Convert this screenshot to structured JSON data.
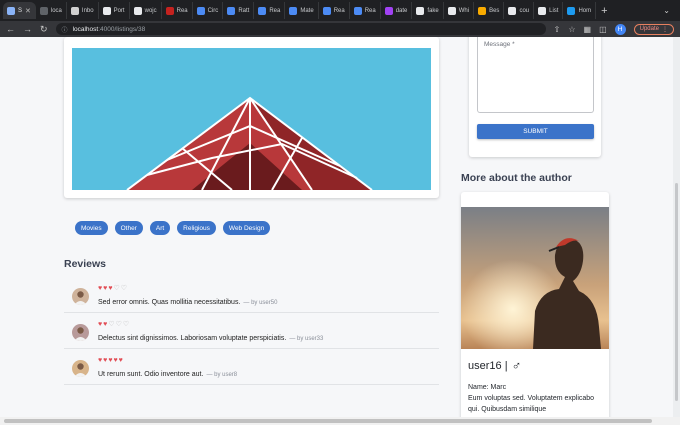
{
  "browser": {
    "tabs": [
      {
        "label": "S",
        "color": "#8ab4f8",
        "active": true
      },
      {
        "label": "loca",
        "color": "#5f6368"
      },
      {
        "label": "Inbo",
        "color": "#d0d0d0"
      },
      {
        "label": "Port",
        "color": "#e8eaed"
      },
      {
        "label": "wojc",
        "color": "#e8eaed"
      },
      {
        "label": "Rea",
        "color": "#c5221f"
      },
      {
        "label": "Circ",
        "color": "#4c8bf5"
      },
      {
        "label": "Ratt",
        "color": "#4c8bf5"
      },
      {
        "label": "Rea",
        "color": "#4c8bf5"
      },
      {
        "label": "Mate",
        "color": "#4c8bf5"
      },
      {
        "label": "Rea",
        "color": "#4c8bf5"
      },
      {
        "label": "Rea",
        "color": "#4c8bf5"
      },
      {
        "label": "date",
        "color": "#a142f4"
      },
      {
        "label": "fake",
        "color": "#e8eaed"
      },
      {
        "label": "Whi",
        "color": "#e8eaed"
      },
      {
        "label": "Bes",
        "color": "#f9ab00"
      },
      {
        "label": "cou",
        "color": "#e8eaed"
      },
      {
        "label": "List",
        "color": "#e8eaed"
      },
      {
        "label": "Hom",
        "color": "#1d9bf0"
      }
    ],
    "url_host": "localhost",
    "url_path": ":4000/listings/38",
    "profile_initial": "H",
    "update_label": "Update"
  },
  "tags": [
    "Movies",
    "Other",
    "Art",
    "Religious",
    "Web Design"
  ],
  "reviews_title": "Reviews",
  "reviews": [
    {
      "rating": 3,
      "text": "Sed error omnis. Quas mollitia necessitatibus.",
      "by": "— by user50"
    },
    {
      "rating": 2,
      "text": "Delectus sint dignissimos. Laboriosam voluptate perspiciatis.",
      "by": "— by user33"
    },
    {
      "rating": 5,
      "text": "Ut rerum sunt. Odio inventore aut.",
      "by": "— by user8"
    }
  ],
  "contact": {
    "message_label": "Message *",
    "submit_label": "SUBMIT"
  },
  "author": {
    "section_title": "More about the author",
    "name": "user16 |",
    "gender_icon": "male-icon",
    "real_name": "Name: Marc",
    "bio": "Eum voluptas sed. Voluptatem explicabo qui. Quibusdam similique"
  },
  "colors": {
    "primary": "#3b73c9",
    "heart": "#e24d55",
    "hero_sky": "#58bfdf",
    "hero_building": "#b8383a"
  }
}
